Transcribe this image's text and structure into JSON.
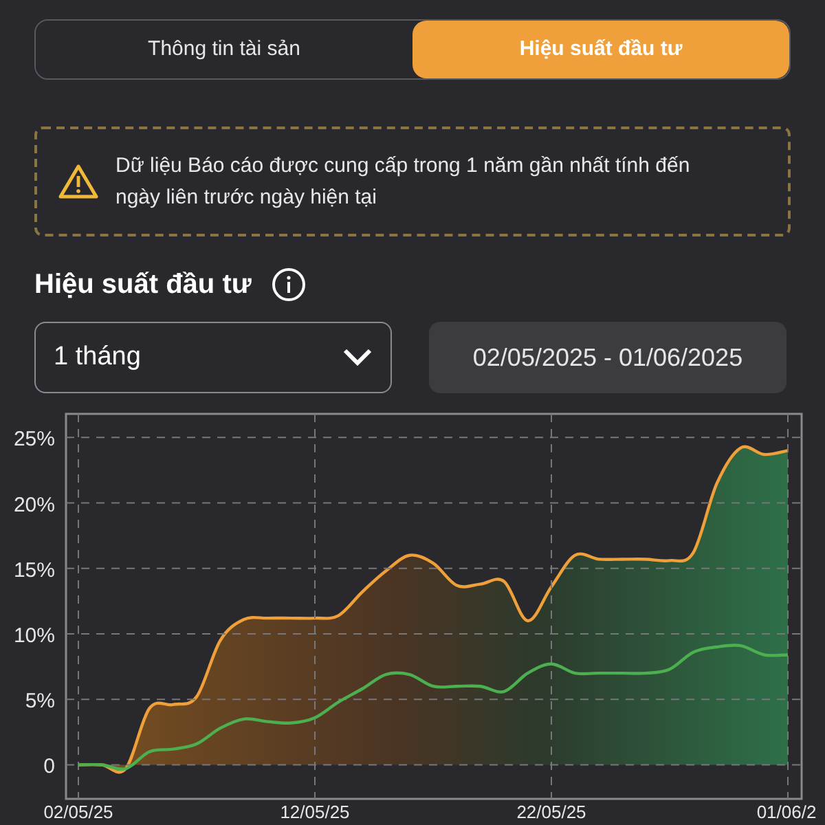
{
  "tabs": [
    {
      "label": "Thông tin tài sản",
      "selected": false
    },
    {
      "label": "Hiệu suất đầu tư",
      "selected": true
    }
  ],
  "notice": {
    "text": "Dữ liệu Báo cáo được cung cấp trong 1 năm gần nhất tính đến ngày liên trước ngày hiện tại"
  },
  "section_title": "Hiệu suất đầu tư",
  "period_select": {
    "value": "1 tháng"
  },
  "date_range": "02/05/2025 - 01/06/2025",
  "chart_data": {
    "type": "area",
    "grid": true,
    "categories": [
      "02/05/25",
      null,
      null,
      null,
      null,
      null,
      null,
      null,
      null,
      null,
      "12/05/25",
      null,
      null,
      null,
      null,
      null,
      null,
      null,
      null,
      null,
      "22/05/25",
      null,
      null,
      null,
      null,
      null,
      null,
      null,
      null,
      null,
      "01/06/2"
    ],
    "series": [
      {
        "color": "#f0a03a",
        "values": [
          0,
          0,
          -0.3,
          4.3,
          4.6,
          5.2,
          9.5,
          11.1,
          11.2,
          11.2,
          11.2,
          11.4,
          13.2,
          14.8,
          16,
          15.4,
          13.7,
          13.8,
          14,
          11,
          13.6,
          16,
          15.7,
          15.7,
          15.7,
          15.6,
          16.2,
          21.5,
          24.2,
          23.7,
          24
        ]
      },
      {
        "type": "line",
        "color": "#4caf50",
        "values": [
          0,
          0,
          -0.3,
          1,
          1.2,
          1.6,
          2.8,
          3.5,
          3.3,
          3.2,
          3.6,
          4.8,
          5.8,
          6.9,
          6.9,
          6,
          6,
          6,
          5.6,
          7,
          7.7,
          7,
          7,
          7,
          7,
          7.3,
          8.6,
          9,
          9.1,
          8.4,
          8.4
        ]
      }
    ],
    "ylim": [
      -2.6,
      26.8
    ],
    "yticks": [
      {
        "value": 0,
        "label": "0"
      },
      {
        "value": 5,
        "label": "5%"
      },
      {
        "value": 10,
        "label": "10%"
      },
      {
        "value": 15,
        "label": "15%"
      },
      {
        "value": 20,
        "label": "20%"
      },
      {
        "value": 25,
        "label": "25%"
      }
    ]
  }
}
